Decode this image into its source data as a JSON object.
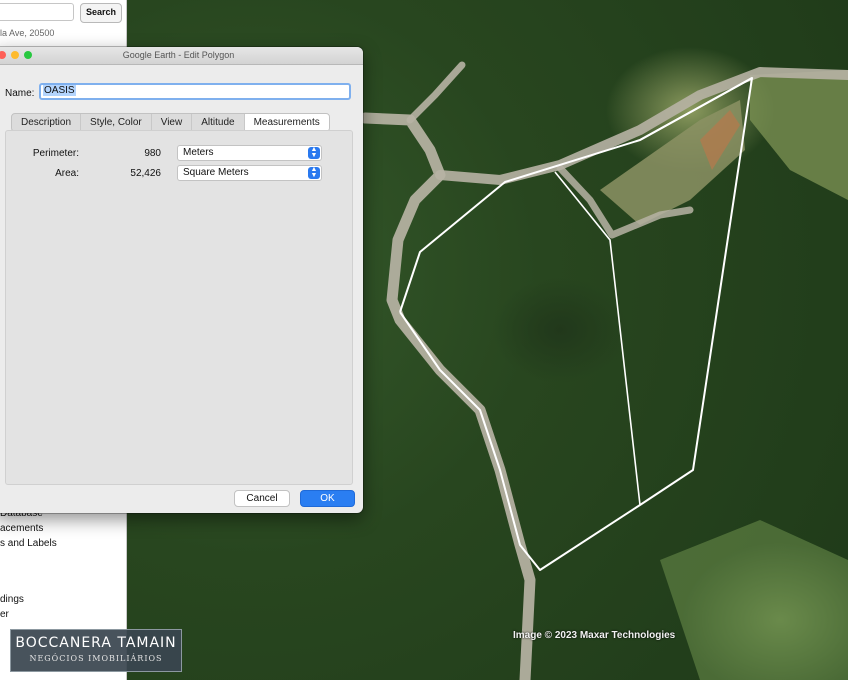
{
  "sidebar": {
    "search_button": "Search",
    "address_text": "la Ave, 20500",
    "layers": [
      "Database",
      "acements",
      "s and Labels",
      "dings",
      "er"
    ]
  },
  "dialog": {
    "title": "Google Earth - Edit Polygon",
    "name_label": "Name:",
    "name_value": "OASIS",
    "tabs": [
      {
        "label": "Description"
      },
      {
        "label": "Style, Color"
      },
      {
        "label": "View"
      },
      {
        "label": "Altitude"
      },
      {
        "label": "Measurements",
        "active": true
      }
    ],
    "measurements": {
      "perimeter_label": "Perimeter:",
      "perimeter_value": "980",
      "perimeter_unit": "Meters",
      "area_label": "Area:",
      "area_value": "52,426",
      "area_unit": "Square Meters"
    },
    "cancel_label": "Cancel",
    "ok_label": "OK"
  },
  "map": {
    "credit": "Image © 2023 Maxar Technologies"
  },
  "logo": {
    "line1": "BOCCANERA TAMAIN",
    "line2": "NEGÓCIOS IMOBILIÁRIOS"
  },
  "colors": {
    "accent": "#2a7ef2",
    "polygon_outline": "#ffffff",
    "road": "#b8b4a6"
  }
}
